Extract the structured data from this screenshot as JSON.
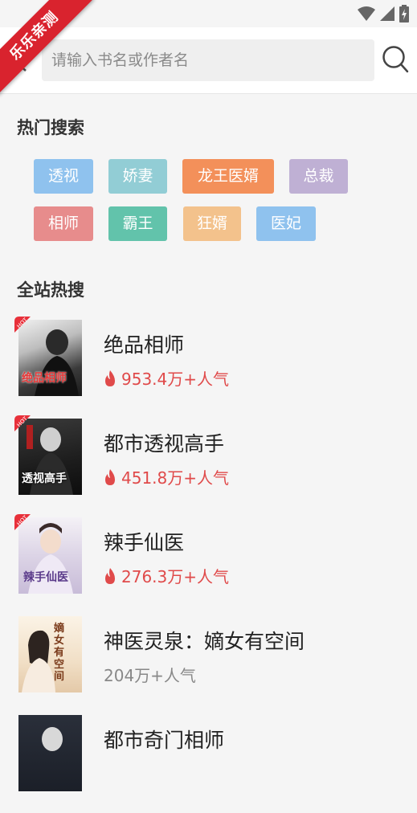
{
  "ribbon": {
    "text": "乐乐亲测"
  },
  "search": {
    "placeholder": "请输入书名或作者名"
  },
  "hot_search": {
    "title": "热门搜索",
    "tags": [
      {
        "label": "透视",
        "color": "#8fc2ee"
      },
      {
        "label": "娇妻",
        "color": "#92cdd5"
      },
      {
        "label": "龙王医婿",
        "color": "#f3905a"
      },
      {
        "label": "总裁",
        "color": "#bfb0d4"
      },
      {
        "label": "相师",
        "color": "#e78c8c"
      },
      {
        "label": "霸王",
        "color": "#62c3ab"
      },
      {
        "label": "狂婿",
        "color": "#f3c28c"
      },
      {
        "label": "医妃",
        "color": "#8fc2ee"
      }
    ]
  },
  "hot_list": {
    "title": "全站热搜",
    "books": [
      {
        "title": "绝品相师",
        "popularity": "953.4万+人气",
        "hot": true,
        "cover_text": "绝品相师"
      },
      {
        "title": "都市透视高手",
        "popularity": "451.8万+人气",
        "hot": true,
        "cover_text": "透视高手"
      },
      {
        "title": "辣手仙医",
        "popularity": "276.3万+人气",
        "hot": true,
        "cover_text": "辣手仙医"
      },
      {
        "title": "神医灵泉：嫡女有空间",
        "popularity": "204万+人气",
        "hot": false,
        "cover_text": "嫡女有空间"
      },
      {
        "title": "都市奇门相师",
        "popularity": "",
        "hot": false,
        "cover_text": ""
      }
    ]
  },
  "colors": {
    "accent": "#e04a4a",
    "ribbon": "#d9232e"
  },
  "hot_badge_text": "HOT"
}
